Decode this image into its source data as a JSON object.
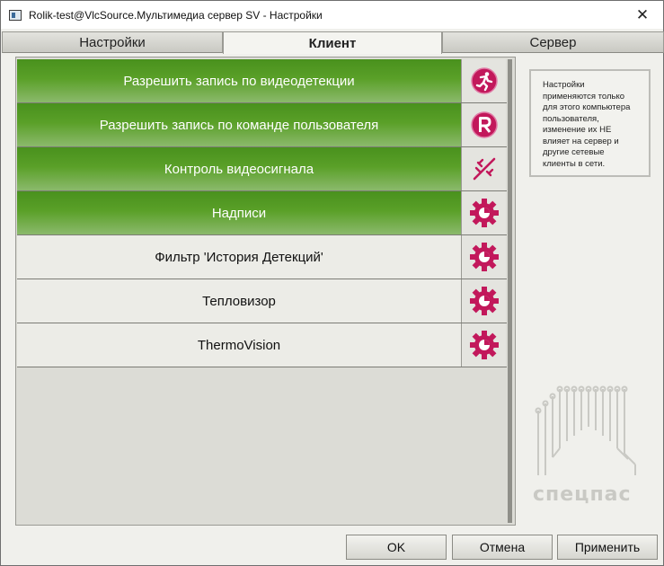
{
  "window": {
    "title": "Rolik-test@VlcSource.Мультимедиа сервер SV - Настройки",
    "close_glyph": "✕"
  },
  "tabs": [
    {
      "label": "Настройки",
      "active": false
    },
    {
      "label": "Клиент",
      "active": true
    },
    {
      "label": "Сервер",
      "active": false
    }
  ],
  "rows": [
    {
      "label": "Разрешить запись по видеодетекции",
      "enabled": true,
      "icon": "motion-run-icon"
    },
    {
      "label": "Разрешить запись по команде пользователя",
      "enabled": true,
      "icon": "record-r-icon"
    },
    {
      "label": "Контроль видеосигнала",
      "enabled": true,
      "icon": "signal-off-icon"
    },
    {
      "label": "Надписи",
      "enabled": true,
      "icon": "gear-icon"
    },
    {
      "label": "Фильтр 'История Детекций'",
      "enabled": false,
      "icon": "gear-icon"
    },
    {
      "label": "Тепловизор",
      "enabled": false,
      "icon": "gear-icon"
    },
    {
      "label": "ThermoVision",
      "enabled": false,
      "icon": "gear-icon"
    }
  ],
  "info": {
    "text": "Настройки применяются только для этого компьютера пользователя, изменение их НЕ влияет на сервер и другие сетевые клиенты в сети."
  },
  "logo": {
    "text": "спецпас"
  },
  "buttons": {
    "ok": "OK",
    "cancel": "Отмена",
    "apply": "Применить"
  },
  "colors": {
    "enabled_green": "#5aa028",
    "icon_magenta": "#c2185b"
  }
}
